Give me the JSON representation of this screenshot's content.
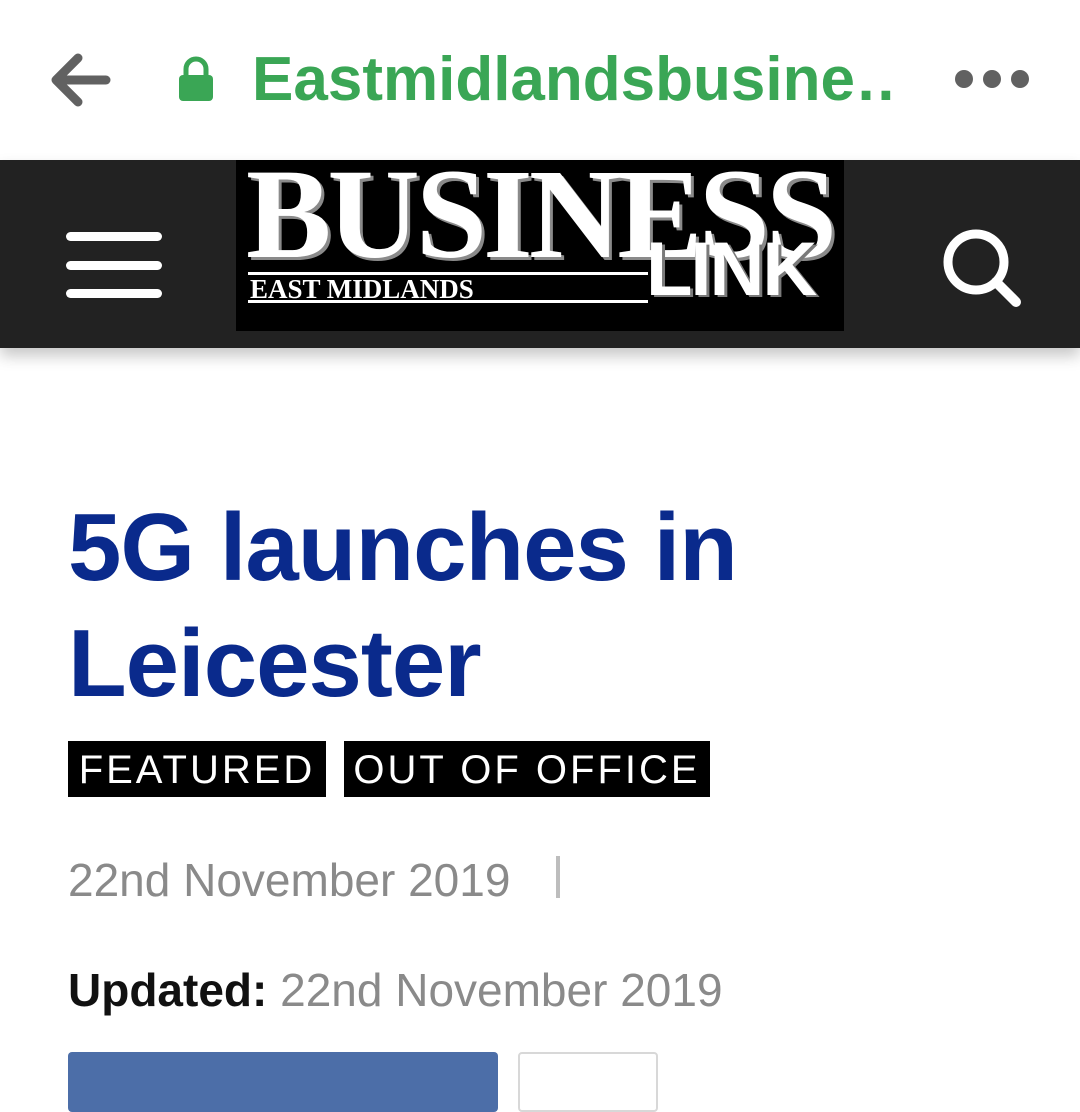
{
  "browser": {
    "url": "Eastmidlandsbusine…",
    "icons": {
      "back": "back-arrow-icon",
      "lock": "lock-icon",
      "more": "more-dots-icon"
    },
    "colors": {
      "url": "#3aa655",
      "icon": "#616161"
    }
  },
  "site_header": {
    "logo": {
      "main": "BUSINESS",
      "sub": "EAST MIDLANDS",
      "link": "LINK"
    },
    "icons": {
      "menu": "hamburger-menu-icon",
      "search": "search-icon"
    },
    "colors": {
      "background": "#222222",
      "logo_bg": "#000000"
    }
  },
  "article": {
    "title": "5G launches in Leicester",
    "tags": [
      "FEATURED",
      "OUT OF OFFICE"
    ],
    "date": "22nd November 2019",
    "updated_label": "Updated:",
    "updated_date": "22nd November 2019",
    "colors": {
      "title": "#0a2a8c",
      "tag_bg": "#000000",
      "meta": "#8a8a8a",
      "share_button": "#4c6ea8"
    }
  }
}
